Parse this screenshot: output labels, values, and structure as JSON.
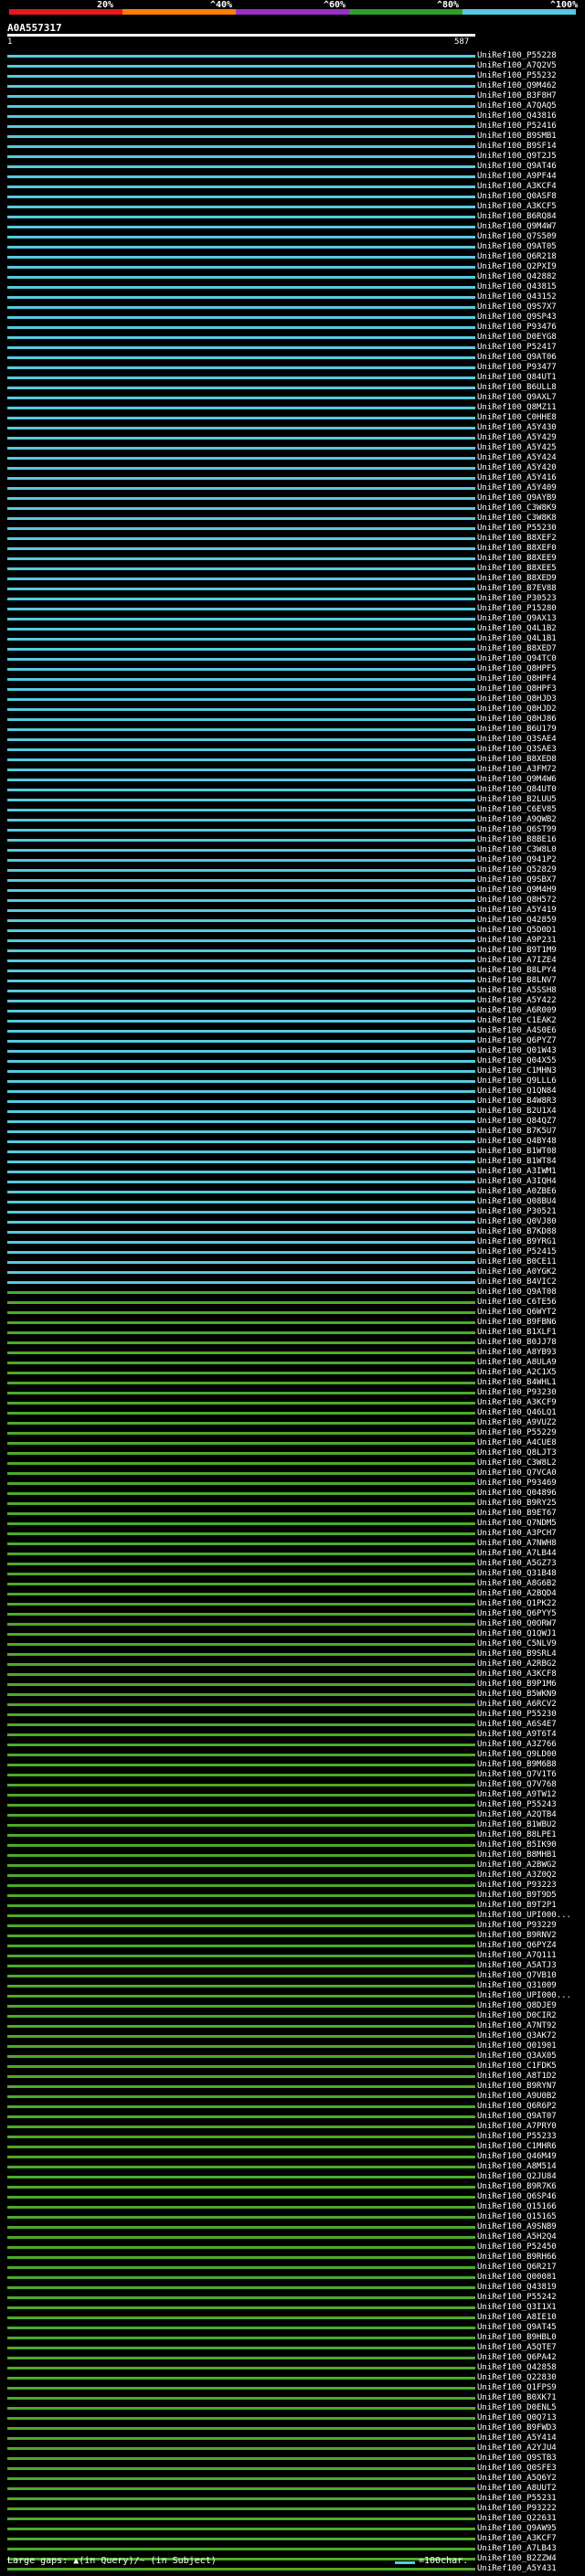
{
  "legend": {
    "colors": [
      "#e41a1c",
      "#ff7f00",
      "#9b30c8",
      "#2ca02c",
      "#55cadf"
    ],
    "labels": [
      "20%",
      "^40%",
      "^60%",
      "^80%",
      "^100%"
    ]
  },
  "query_title": "A0A557317",
  "ruler": {
    "start": "1",
    "end": "587"
  },
  "hits": [
    {
      "id": "UniRef100_P55228",
      "c": "cyan"
    },
    {
      "id": "UniRef100_A7Q2V5",
      "c": "cyan"
    },
    {
      "id": "UniRef100_P55232",
      "c": "cyan"
    },
    {
      "id": "UniRef100_Q9M462",
      "c": "cyan"
    },
    {
      "id": "UniRef100_B3F8H7",
      "c": "cyan"
    },
    {
      "id": "UniRef100_A7QAQ5",
      "c": "cyan"
    },
    {
      "id": "UniRef100_Q43816",
      "c": "cyan"
    },
    {
      "id": "UniRef100_P52416",
      "c": "cyan"
    },
    {
      "id": "UniRef100_B9SMB1",
      "c": "cyan"
    },
    {
      "id": "UniRef100_B9SF14",
      "c": "cyan"
    },
    {
      "id": "UniRef100_Q9T2J5",
      "c": "cyan"
    },
    {
      "id": "UniRef100_Q9AT46",
      "c": "cyan"
    },
    {
      "id": "UniRef100_A9PF44",
      "c": "cyan"
    },
    {
      "id": "UniRef100_A3KCF4",
      "c": "cyan"
    },
    {
      "id": "UniRef100_Q0ASF8",
      "c": "cyan"
    },
    {
      "id": "UniRef100_A3KCF5",
      "c": "cyan"
    },
    {
      "id": "UniRef100_B6RQ84",
      "c": "cyan"
    },
    {
      "id": "UniRef100_Q9M4W7",
      "c": "cyan"
    },
    {
      "id": "UniRef100_Q7S509",
      "c": "cyan"
    },
    {
      "id": "UniRef100_Q9AT05",
      "c": "cyan"
    },
    {
      "id": "UniRef100_Q6R218",
      "c": "cyan"
    },
    {
      "id": "UniRef100_Q2PXI9",
      "c": "cyan"
    },
    {
      "id": "UniRef100_Q42882",
      "c": "cyan"
    },
    {
      "id": "UniRef100_Q43815",
      "c": "cyan"
    },
    {
      "id": "UniRef100_Q43152",
      "c": "cyan"
    },
    {
      "id": "UniRef100_Q9S7X7",
      "c": "cyan"
    },
    {
      "id": "UniRef100_Q9SP43",
      "c": "cyan"
    },
    {
      "id": "UniRef100_P93476",
      "c": "cyan"
    },
    {
      "id": "UniRef100_D0EYG8",
      "c": "cyan"
    },
    {
      "id": "UniRef100_P52417",
      "c": "cyan"
    },
    {
      "id": "UniRef100_Q9AT06",
      "c": "cyan"
    },
    {
      "id": "UniRef100_P93477",
      "c": "cyan"
    },
    {
      "id": "UniRef100_Q84UT1",
      "c": "cyan"
    },
    {
      "id": "UniRef100_B6ULL8",
      "c": "cyan"
    },
    {
      "id": "UniRef100_Q9AXL7",
      "c": "cyan"
    },
    {
      "id": "UniRef100_Q8MZ11",
      "c": "cyan"
    },
    {
      "id": "UniRef100_C0HHE8",
      "c": "cyan"
    },
    {
      "id": "UniRef100_A5Y430",
      "c": "cyan"
    },
    {
      "id": "UniRef100_A5Y429",
      "c": "cyan"
    },
    {
      "id": "UniRef100_A5Y425",
      "c": "cyan"
    },
    {
      "id": "UniRef100_A5Y424",
      "c": "cyan"
    },
    {
      "id": "UniRef100_A5Y420",
      "c": "cyan"
    },
    {
      "id": "UniRef100_A5Y416",
      "c": "cyan"
    },
    {
      "id": "UniRef100_A5Y409",
      "c": "cyan"
    },
    {
      "id": "UniRef100_Q9AYB9",
      "c": "cyan"
    },
    {
      "id": "UniRef100_C3W8K9",
      "c": "cyan"
    },
    {
      "id": "UniRef100_C3W8K8",
      "c": "cyan"
    },
    {
      "id": "UniRef100_P55230",
      "c": "cyan"
    },
    {
      "id": "UniRef100_B8XEF2",
      "c": "cyan"
    },
    {
      "id": "UniRef100_B8XEF0",
      "c": "cyan"
    },
    {
      "id": "UniRef100_B8XEE9",
      "c": "cyan"
    },
    {
      "id": "UniRef100_B8XEE5",
      "c": "cyan"
    },
    {
      "id": "UniRef100_B8XED9",
      "c": "cyan"
    },
    {
      "id": "UniRef100_B7EV88",
      "c": "cyan"
    },
    {
      "id": "UniRef100_P30523",
      "c": "cyan"
    },
    {
      "id": "UniRef100_P15280",
      "c": "cyan"
    },
    {
      "id": "UniRef100_Q9AX13",
      "c": "cyan"
    },
    {
      "id": "UniRef100_Q4L1B2",
      "c": "cyan"
    },
    {
      "id": "UniRef100_Q4L1B1",
      "c": "cyan"
    },
    {
      "id": "UniRef100_B8XED7",
      "c": "cyan"
    },
    {
      "id": "UniRef100_Q94TC0",
      "c": "cyan"
    },
    {
      "id": "UniRef100_Q8HPF5",
      "c": "cyan"
    },
    {
      "id": "UniRef100_Q8HPF4",
      "c": "cyan"
    },
    {
      "id": "UniRef100_Q8HPF3",
      "c": "cyan"
    },
    {
      "id": "UniRef100_Q8HJD3",
      "c": "cyan"
    },
    {
      "id": "UniRef100_Q8HJD2",
      "c": "cyan"
    },
    {
      "id": "UniRef100_Q8HJ86",
      "c": "cyan"
    },
    {
      "id": "UniRef100_B6U179",
      "c": "cyan"
    },
    {
      "id": "UniRef100_Q3SAE4",
      "c": "cyan"
    },
    {
      "id": "UniRef100_Q3SAE3",
      "c": "cyan"
    },
    {
      "id": "UniRef100_B8XED8",
      "c": "cyan"
    },
    {
      "id": "UniRef100_A3FM72",
      "c": "cyan"
    },
    {
      "id": "UniRef100_Q9M4W6",
      "c": "cyan"
    },
    {
      "id": "UniRef100_Q84UT0",
      "c": "cyan"
    },
    {
      "id": "UniRef100_B2LUU5",
      "c": "cyan"
    },
    {
      "id": "UniRef100_C6EV85",
      "c": "cyan"
    },
    {
      "id": "UniRef100_A9QWB2",
      "c": "cyan"
    },
    {
      "id": "UniRef100_Q6ST99",
      "c": "cyan"
    },
    {
      "id": "UniRef100_B8BE16",
      "c": "cyan"
    },
    {
      "id": "UniRef100_C3W8L0",
      "c": "cyan"
    },
    {
      "id": "UniRef100_Q941P2",
      "c": "cyan"
    },
    {
      "id": "UniRef100_Q52829",
      "c": "cyan"
    },
    {
      "id": "UniRef100_Q9SBX7",
      "c": "cyan"
    },
    {
      "id": "UniRef100_Q9M4H9",
      "c": "cyan"
    },
    {
      "id": "UniRef100_Q8H572",
      "c": "cyan"
    },
    {
      "id": "UniRef100_A5Y419",
      "c": "cyan"
    },
    {
      "id": "UniRef100_Q42859",
      "c": "cyan"
    },
    {
      "id": "UniRef100_Q5D0D1",
      "c": "cyan"
    },
    {
      "id": "UniRef100_A9P231",
      "c": "cyan"
    },
    {
      "id": "UniRef100_B9T1M9",
      "c": "cyan"
    },
    {
      "id": "UniRef100_A7IZE4",
      "c": "cyan"
    },
    {
      "id": "UniRef100_B8LPY4",
      "c": "cyan"
    },
    {
      "id": "UniRef100_B8LNV7",
      "c": "cyan"
    },
    {
      "id": "UniRef100_A5SSH8",
      "c": "cyan"
    },
    {
      "id": "UniRef100_A5Y422",
      "c": "cyan"
    },
    {
      "id": "UniRef100_A6R009",
      "c": "cyan"
    },
    {
      "id": "UniRef100_C1EAK2",
      "c": "cyan"
    },
    {
      "id": "UniRef100_A4S0E6",
      "c": "cyan"
    },
    {
      "id": "UniRef100_Q6PYZ7",
      "c": "cyan"
    },
    {
      "id": "UniRef100_Q01W43",
      "c": "cyan"
    },
    {
      "id": "UniRef100_Q04X55",
      "c": "cyan"
    },
    {
      "id": "UniRef100_C1MHN3",
      "c": "cyan"
    },
    {
      "id": "UniRef100_Q9LLL6",
      "c": "cyan"
    },
    {
      "id": "UniRef100_Q1QN84",
      "c": "cyan"
    },
    {
      "id": "UniRef100_B4W8R3",
      "c": "cyan"
    },
    {
      "id": "UniRef100_B2U1X4",
      "c": "cyan"
    },
    {
      "id": "UniRef100_Q84QZ7",
      "c": "cyan"
    },
    {
      "id": "UniRef100_B7K5U7",
      "c": "cyan"
    },
    {
      "id": "UniRef100_Q4BY48",
      "c": "cyan"
    },
    {
      "id": "UniRef100_B1WT08",
      "c": "cyan"
    },
    {
      "id": "UniRef100_B1WT84",
      "c": "cyan"
    },
    {
      "id": "UniRef100_A3IWM1",
      "c": "cyan"
    },
    {
      "id": "UniRef100_A3IQH4",
      "c": "cyan"
    },
    {
      "id": "UniRef100_A0ZBE6",
      "c": "cyan"
    },
    {
      "id": "UniRef100_Q08BU4",
      "c": "cyan"
    },
    {
      "id": "UniRef100_P30521",
      "c": "cyan"
    },
    {
      "id": "UniRef100_Q0VJ80",
      "c": "cyan"
    },
    {
      "id": "UniRef100_B7KD88",
      "c": "cyan"
    },
    {
      "id": "UniRef100_B9YRG1",
      "c": "cyan"
    },
    {
      "id": "UniRef100_P52415",
      "c": "cyan"
    },
    {
      "id": "UniRef100_B0CE11",
      "c": "cyan"
    },
    {
      "id": "UniRef100_A0YGK2",
      "c": "cyan"
    },
    {
      "id": "UniRef100_B4VIC2",
      "c": "cyan"
    },
    {
      "id": "UniRef100_Q9AT08",
      "c": "green"
    },
    {
      "id": "UniRef100_C6TE56",
      "c": "green"
    },
    {
      "id": "UniRef100_Q6WYT2",
      "c": "green"
    },
    {
      "id": "UniRef100_B9FBN6",
      "c": "green"
    },
    {
      "id": "UniRef100_B1XLF1",
      "c": "green"
    },
    {
      "id": "UniRef100_B0JJ78",
      "c": "green"
    },
    {
      "id": "UniRef100_A8YB93",
      "c": "green"
    },
    {
      "id": "UniRef100_A8ULA9",
      "c": "green"
    },
    {
      "id": "UniRef100_A2C1X5",
      "c": "green"
    },
    {
      "id": "UniRef100_B4WHL1",
      "c": "green"
    },
    {
      "id": "UniRef100_P93230",
      "c": "green"
    },
    {
      "id": "UniRef100_A3KCF9",
      "c": "green"
    },
    {
      "id": "UniRef100_Q46LQ1",
      "c": "green"
    },
    {
      "id": "UniRef100_A9VUZ2",
      "c": "green"
    },
    {
      "id": "UniRef100_P55229",
      "c": "green"
    },
    {
      "id": "UniRef100_A4CUE8",
      "c": "green"
    },
    {
      "id": "UniRef100_Q8LJT3",
      "c": "green"
    },
    {
      "id": "UniRef100_C3W8L2",
      "c": "green"
    },
    {
      "id": "UniRef100_Q7VCA0",
      "c": "green"
    },
    {
      "id": "UniRef100_P93469",
      "c": "green"
    },
    {
      "id": "UniRef100_Q04896",
      "c": "green"
    },
    {
      "id": "UniRef100_B9RY25",
      "c": "green"
    },
    {
      "id": "UniRef100_B9ET67",
      "c": "green"
    },
    {
      "id": "UniRef100_Q7NDM5",
      "c": "green"
    },
    {
      "id": "UniRef100_A3PCH7",
      "c": "green"
    },
    {
      "id": "UniRef100_A7NWH8",
      "c": "green"
    },
    {
      "id": "UniRef100_A7LB44",
      "c": "green"
    },
    {
      "id": "UniRef100_A5GZ73",
      "c": "green"
    },
    {
      "id": "UniRef100_Q31B48",
      "c": "green"
    },
    {
      "id": "UniRef100_A8G6B2",
      "c": "green"
    },
    {
      "id": "UniRef100_A2BQD4",
      "c": "green"
    },
    {
      "id": "UniRef100_Q1PK22",
      "c": "green"
    },
    {
      "id": "UniRef100_Q6PYY5",
      "c": "green"
    },
    {
      "id": "UniRef100_Q0ORW7",
      "c": "green"
    },
    {
      "id": "UniRef100_Q1QWJ1",
      "c": "green"
    },
    {
      "id": "UniRef100_C5NLV9",
      "c": "green"
    },
    {
      "id": "UniRef100_B9SRL4",
      "c": "green"
    },
    {
      "id": "UniRef100_A2RBG2",
      "c": "green"
    },
    {
      "id": "UniRef100_A3KCF8",
      "c": "green"
    },
    {
      "id": "UniRef100_B9P1M6",
      "c": "green"
    },
    {
      "id": "UniRef100_B5WKN9",
      "c": "green"
    },
    {
      "id": "UniRef100_A6RCV2",
      "c": "green"
    },
    {
      "id": "UniRef100_P55230",
      "c": "green"
    },
    {
      "id": "UniRef100_A6S4E7",
      "c": "green"
    },
    {
      "id": "UniRef100_A9T6T4",
      "c": "green"
    },
    {
      "id": "UniRef100_A3Z766",
      "c": "green"
    },
    {
      "id": "UniRef100_Q9LD00",
      "c": "green"
    },
    {
      "id": "UniRef100_B9M6B8",
      "c": "green"
    },
    {
      "id": "UniRef100_Q7V1T6",
      "c": "green"
    },
    {
      "id": "UniRef100_Q7V768",
      "c": "green"
    },
    {
      "id": "UniRef100_A9TW12",
      "c": "green"
    },
    {
      "id": "UniRef100_P55243",
      "c": "green"
    },
    {
      "id": "UniRef100_A2QTB4",
      "c": "green"
    },
    {
      "id": "UniRef100_B1WBU2",
      "c": "green"
    },
    {
      "id": "UniRef100_B8LPE1",
      "c": "green"
    },
    {
      "id": "UniRef100_B5IK90",
      "c": "green"
    },
    {
      "id": "UniRef100_B8MHB1",
      "c": "green"
    },
    {
      "id": "UniRef100_A2BWG2",
      "c": "green"
    },
    {
      "id": "UniRef100_A3Z0Q2",
      "c": "green"
    },
    {
      "id": "UniRef100_P93223",
      "c": "green"
    },
    {
      "id": "UniRef100_B9T9D5",
      "c": "green"
    },
    {
      "id": "UniRef100_B9T2P1",
      "c": "green"
    },
    {
      "id": "UniRef100_UPI000...",
      "c": "green"
    },
    {
      "id": "UniRef100_P93229",
      "c": "green"
    },
    {
      "id": "UniRef100_B9RNV2",
      "c": "green"
    },
    {
      "id": "UniRef100_Q6PYZ4",
      "c": "green"
    },
    {
      "id": "UniRef100_A7Q111",
      "c": "green"
    },
    {
      "id": "UniRef100_A5ATJ3",
      "c": "green"
    },
    {
      "id": "UniRef100_Q7VB10",
      "c": "green"
    },
    {
      "id": "UniRef100_Q31009",
      "c": "green"
    },
    {
      "id": "UniRef100_UPI000...",
      "c": "green"
    },
    {
      "id": "UniRef100_Q8DJE9",
      "c": "green"
    },
    {
      "id": "UniRef100_D0CIR2",
      "c": "green"
    },
    {
      "id": "UniRef100_A7NT92",
      "c": "green"
    },
    {
      "id": "UniRef100_Q3AK72",
      "c": "green"
    },
    {
      "id": "UniRef100_Q01901",
      "c": "green"
    },
    {
      "id": "UniRef100_Q3AX05",
      "c": "green"
    },
    {
      "id": "UniRef100_C1FDK5",
      "c": "green"
    },
    {
      "id": "UniRef100_A8T1D2",
      "c": "green"
    },
    {
      "id": "UniRef100_B9RYN7",
      "c": "green"
    },
    {
      "id": "UniRef100_A9U0B2",
      "c": "green"
    },
    {
      "id": "UniRef100_Q6R6P2",
      "c": "green"
    },
    {
      "id": "UniRef100_Q9AT07",
      "c": "green"
    },
    {
      "id": "UniRef100_A7PRY0",
      "c": "green"
    },
    {
      "id": "UniRef100_P55233",
      "c": "green"
    },
    {
      "id": "UniRef100_C1MHR6",
      "c": "green"
    },
    {
      "id": "UniRef100_Q46M49",
      "c": "green"
    },
    {
      "id": "UniRef100_A8M514",
      "c": "green"
    },
    {
      "id": "UniRef100_Q2JU84",
      "c": "green"
    },
    {
      "id": "UniRef100_B9R7K6",
      "c": "green"
    },
    {
      "id": "UniRef100_Q6SP46",
      "c": "green"
    },
    {
      "id": "UniRef100_Q15166",
      "c": "green"
    },
    {
      "id": "UniRef100_Q15165",
      "c": "green"
    },
    {
      "id": "UniRef100_A9SNB9",
      "c": "green"
    },
    {
      "id": "UniRef100_A5H2Q4",
      "c": "green"
    },
    {
      "id": "UniRef100_P52450",
      "c": "green"
    },
    {
      "id": "UniRef100_B9RH66",
      "c": "green"
    },
    {
      "id": "UniRef100_Q6R217",
      "c": "green"
    },
    {
      "id": "UniRef100_Q00081",
      "c": "green"
    },
    {
      "id": "UniRef100_Q43819",
      "c": "green"
    },
    {
      "id": "UniRef100_P55242",
      "c": "green"
    },
    {
      "id": "UniRef100_Q3I1X1",
      "c": "green"
    },
    {
      "id": "UniRef100_A8IE10",
      "c": "green"
    },
    {
      "id": "UniRef100_Q9AT45",
      "c": "green"
    },
    {
      "id": "UniRef100_B9HBL0",
      "c": "green"
    },
    {
      "id": "UniRef100_A5QTE7",
      "c": "green"
    },
    {
      "id": "UniRef100_Q6PA42",
      "c": "green"
    },
    {
      "id": "UniRef100_Q42858",
      "c": "green"
    },
    {
      "id": "UniRef100_Q22830",
      "c": "green"
    },
    {
      "id": "UniRef100_Q1FPS9",
      "c": "green"
    },
    {
      "id": "UniRef100_B0XK71",
      "c": "green"
    },
    {
      "id": "UniRef100_D0ENL5",
      "c": "green"
    },
    {
      "id": "UniRef100_Q0Q713",
      "c": "green"
    },
    {
      "id": "UniRef100_B9FWD3",
      "c": "green"
    },
    {
      "id": "UniRef100_A5Y414",
      "c": "green"
    },
    {
      "id": "UniRef100_A2YJU4",
      "c": "green"
    },
    {
      "id": "UniRef100_Q9STB3",
      "c": "green"
    },
    {
      "id": "UniRef100_Q0SFE3",
      "c": "green"
    },
    {
      "id": "UniRef100_A5Q6Y2",
      "c": "green"
    },
    {
      "id": "UniRef100_A8UUT2",
      "c": "green"
    },
    {
      "id": "UniRef100_P55231",
      "c": "green"
    },
    {
      "id": "UniRef100_P93222",
      "c": "green"
    },
    {
      "id": "UniRef100_Q22631",
      "c": "green"
    },
    {
      "id": "UniRef100_Q9AW95",
      "c": "green"
    },
    {
      "id": "UniRef100_A3KCF7",
      "c": "green"
    },
    {
      "id": "UniRef100_A7LB43",
      "c": "green"
    },
    {
      "id": "UniRef100_B2ZZW4",
      "c": "green"
    },
    {
      "id": "UniRef100_A5Y431",
      "c": "green"
    }
  ],
  "footer": {
    "left": "Large gaps: ▲(in Query)/~ (in Subject)",
    "right": "=100char."
  }
}
